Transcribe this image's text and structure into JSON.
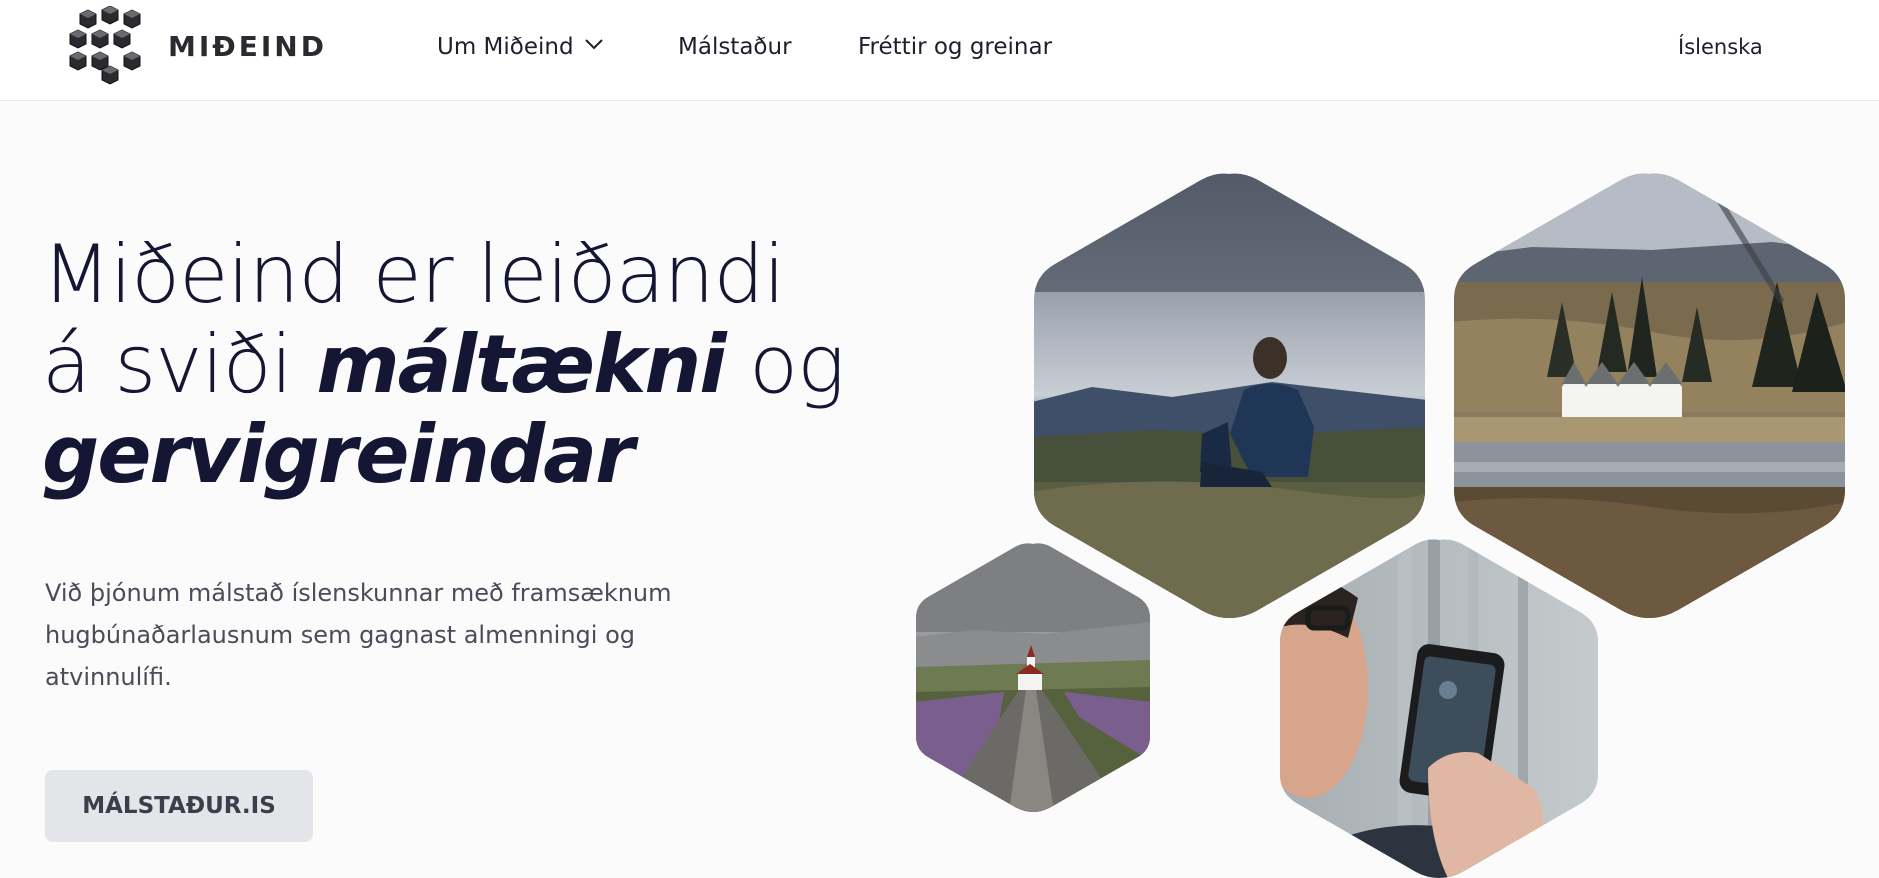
{
  "header": {
    "logo_text": "MIÐEIND",
    "nav": {
      "about": "Um Miðeind",
      "malstadur": "Málstaður",
      "news": "Fréttir og greinar"
    },
    "language": "Íslenska"
  },
  "hero": {
    "headline_part1": "Miðeind er leiðandi",
    "headline_part2a": "á sviði ",
    "headline_emph1": "máltækni",
    "headline_part2b": " og",
    "headline_emph2": "gervigreindar",
    "lead": "Við þjónum málstað íslenskunnar með framsæknum hugbúnaðarlausnum sem gagnast almenningi og atvinnulífi.",
    "cta_label": "MÁLSTAÐUR.IS"
  },
  "colors": {
    "headline": "#141634",
    "button_bg": "#e4e5e9",
    "header_bg": "#ffffff"
  }
}
